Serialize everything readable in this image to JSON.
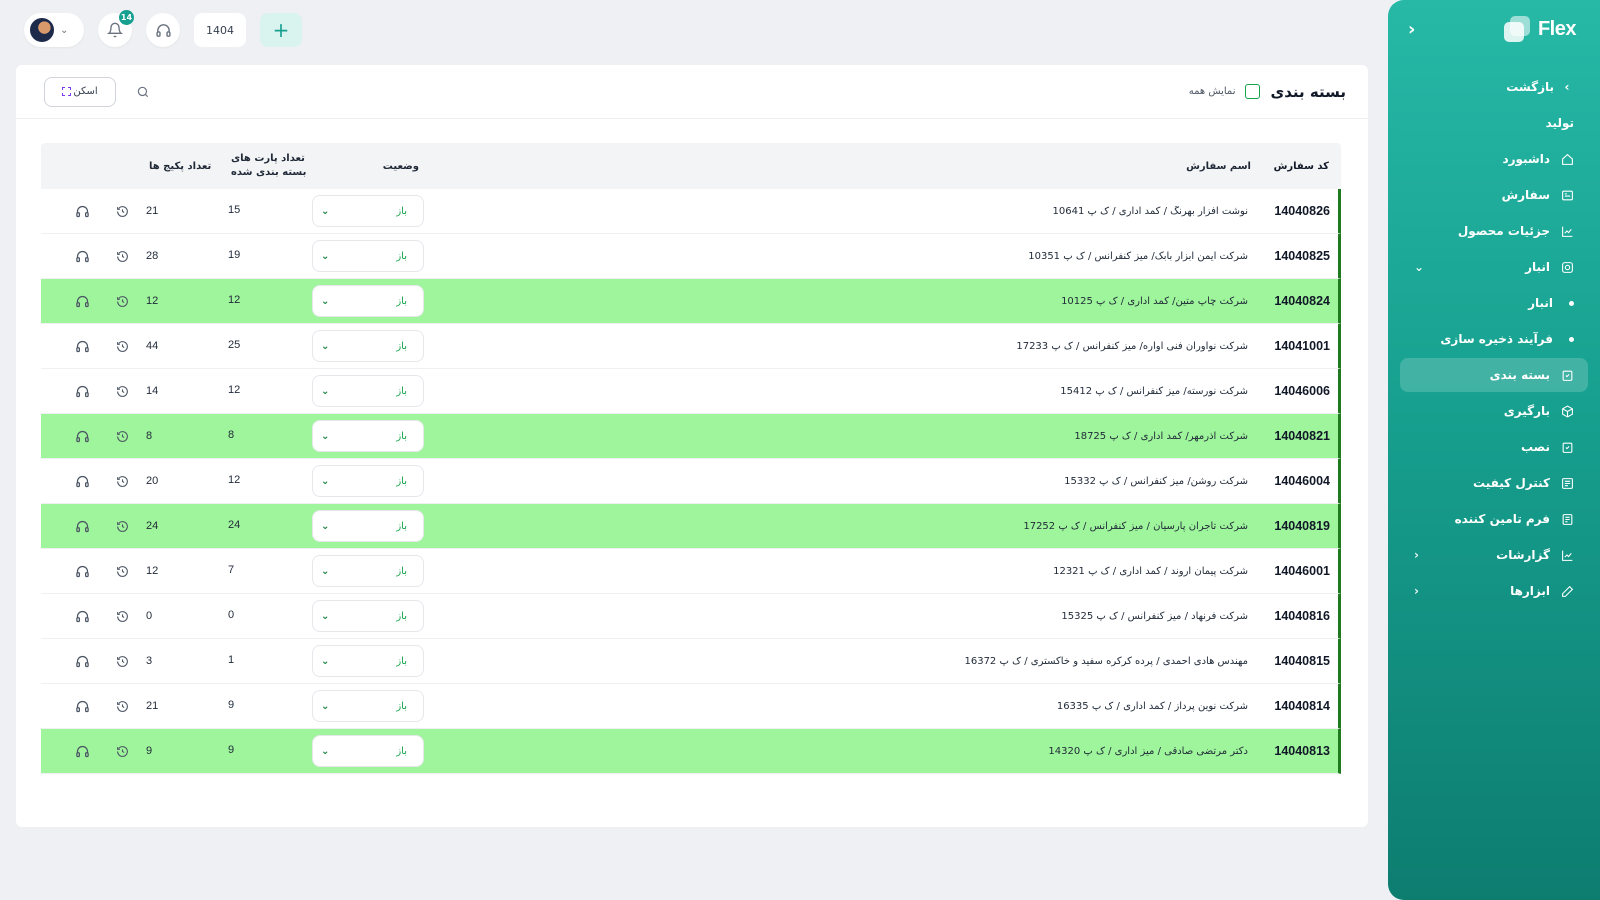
{
  "topbar": {
    "notification_count": "14",
    "year": "1404",
    "add_symbol": "+"
  },
  "sidebar": {
    "brand": "Flex",
    "back_label": "بازگشت",
    "section_label": "تولید",
    "items": [
      {
        "label": "داشبورد",
        "icon": "home-icon"
      },
      {
        "label": "سفارش",
        "icon": "order-icon"
      },
      {
        "label": "جزئیات محصول",
        "icon": "chart-icon"
      },
      {
        "label": "انبار",
        "icon": "warehouse-icon"
      },
      {
        "label": "انبار",
        "icon": "dot"
      },
      {
        "label": "فرآیند ذخیره سازی",
        "icon": "dot"
      },
      {
        "label": "بسته بندی",
        "icon": "package-icon"
      },
      {
        "label": "بارگیری",
        "icon": "loading-icon"
      },
      {
        "label": "نصب",
        "icon": "install-icon"
      },
      {
        "label": "کنترل کیفیت",
        "icon": "quality-icon"
      },
      {
        "label": "فرم تامین کننده",
        "icon": "form-icon"
      },
      {
        "label": "گزارشات",
        "icon": "report-icon"
      },
      {
        "label": "ابزارها",
        "icon": "pencil-icon"
      }
    ]
  },
  "main": {
    "title": "بسته بندی",
    "show_all_label": "نمایش همه",
    "scan_label": "اسکن"
  },
  "table": {
    "headers": {
      "code": "کد سفارش",
      "name": "اسم سفارش",
      "status": "وضعیت",
      "parts_line1": "تعداد پارت های",
      "parts_line2": "بسته بندی شده",
      "packages": "تعداد پکیج ها"
    },
    "rows": [
      {
        "code": "14040826",
        "name": "نوشت افزار بهرنگ / کمد اداری / ک پ 10641",
        "status": "باز",
        "parts": "15",
        "packages": "21",
        "highlighted": false
      },
      {
        "code": "14040825",
        "name": "شرکت ایمن ابزار بابک/ میز کنفرانس / ک پ 10351",
        "status": "باز",
        "parts": "19",
        "packages": "28",
        "highlighted": false
      },
      {
        "code": "14040824",
        "name": "شرکت چاپ متین/ کمد اداری / ک پ 10125",
        "status": "باز",
        "parts": "12",
        "packages": "12",
        "highlighted": true
      },
      {
        "code": "14041001",
        "name": "شرکت نوآوران فنی آواره/ میز کنفرانس / ک پ 17233",
        "status": "باز",
        "parts": "25",
        "packages": "44",
        "highlighted": false
      },
      {
        "code": "14046006",
        "name": "شرکت نورسته/ میز کنفرانس / ک پ 15412",
        "status": "باز",
        "parts": "12",
        "packages": "14",
        "highlighted": false
      },
      {
        "code": "14040821",
        "name": "شرکت آذرمهر/ کمد اداری / ک پ 18725",
        "status": "باز",
        "parts": "8",
        "packages": "8",
        "highlighted": true
      },
      {
        "code": "14046004",
        "name": "شرکت روشن/ میز کنفرانس / ک پ 15332",
        "status": "باز",
        "parts": "12",
        "packages": "20",
        "highlighted": false
      },
      {
        "code": "14040819",
        "name": "شرکت تاجران پارسیان / میز کنفرانس / ک پ 17252",
        "status": "باز",
        "parts": "24",
        "packages": "24",
        "highlighted": true
      },
      {
        "code": "14046001",
        "name": "شرکت پیمان اروند / کمد اداری / ک پ 12321",
        "status": "باز",
        "parts": "7",
        "packages": "12",
        "highlighted": false
      },
      {
        "code": "14040816",
        "name": "شرکت فرنهاد / میز کنفرانس / ک پ 15325",
        "status": "باز",
        "parts": "0",
        "packages": "0",
        "highlighted": false
      },
      {
        "code": "14040815",
        "name": "مهندس هادی احمدی / پرده کرکره سفید و خاکستری / ک پ 16372",
        "status": "باز",
        "parts": "1",
        "packages": "3",
        "highlighted": false
      },
      {
        "code": "14040814",
        "name": "شرکت نوین پرداز / کمد اداری / ک پ 16335",
        "status": "باز",
        "parts": "9",
        "packages": "21",
        "highlighted": false
      },
      {
        "code": "14040813",
        "name": "دکتر مرتضی صادقی / میز اداری / ک پ 14320",
        "status": "باز",
        "parts": "9",
        "packages": "9",
        "highlighted": true
      }
    ]
  },
  "colors": {
    "sidebar_accent": "#17a08f",
    "row_highlight": "#9ff59c",
    "status_text": "#16a34a"
  }
}
